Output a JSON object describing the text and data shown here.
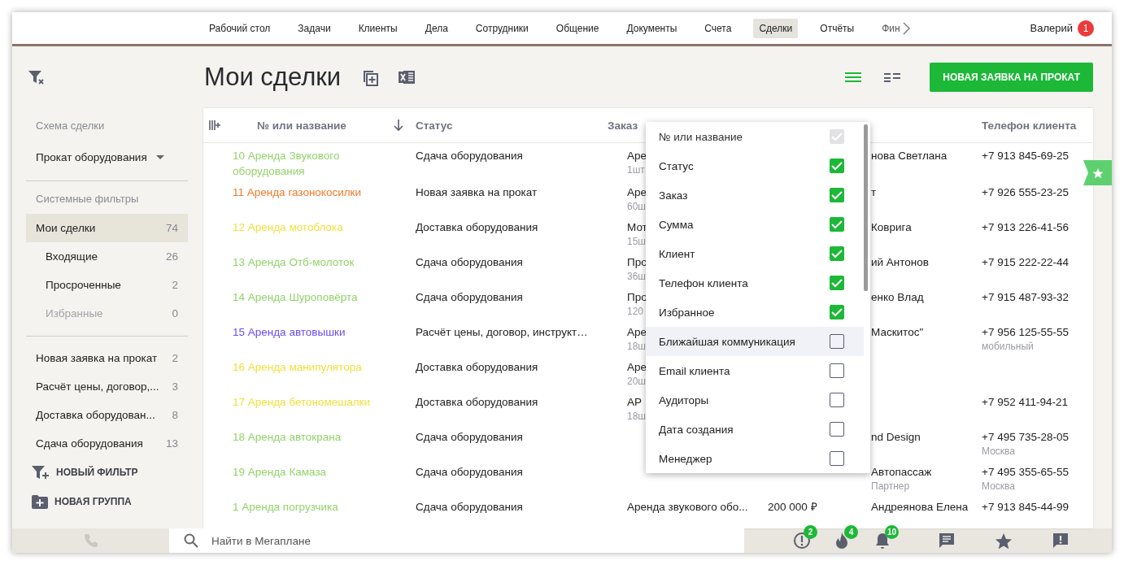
{
  "top_nav": {
    "tabs": [
      {
        "label": "Рабочий стол",
        "selected": false
      },
      {
        "label": "Задачи",
        "selected": false
      },
      {
        "label": "Клиенты",
        "selected": false
      },
      {
        "label": "Дела",
        "selected": false
      },
      {
        "label": "Сотрудники",
        "selected": false
      },
      {
        "label": "Общение",
        "selected": false
      },
      {
        "label": "Документы",
        "selected": false
      },
      {
        "label": "Счета",
        "selected": false
      },
      {
        "label": "Сделки",
        "selected": true
      },
      {
        "label": "Отчёты",
        "selected": false
      },
      {
        "label": "Фин",
        "selected": false
      }
    ],
    "user": {
      "name": "Валерий",
      "badge": "1"
    }
  },
  "sidebar": {
    "scheme_label": "Схема сделки",
    "scheme_value": "Прокат оборудования",
    "system_filters_label": "Системные фильтры",
    "system_filters": [
      {
        "label": "Мои сделки",
        "count": "74",
        "selected": true,
        "disabled": false,
        "children": [
          {
            "label": "Входящие",
            "count": "26",
            "selected": false,
            "disabled": false
          },
          {
            "label": "Просроченные",
            "count": "2",
            "selected": false,
            "disabled": false
          },
          {
            "label": "Избранные",
            "count": "0",
            "selected": false,
            "disabled": true
          }
        ]
      }
    ],
    "groups": [
      {
        "label": "Новая заявка на прокат",
        "count": "2"
      },
      {
        "label": "Расчёт цены, договор,...",
        "count": "3"
      },
      {
        "label": "Доставка оборудован...",
        "count": "8"
      },
      {
        "label": "Сдача оборудования",
        "count": "13"
      }
    ],
    "actions": [
      {
        "kind": "filter",
        "label": "НОВЫЙ ФИЛЬТР"
      },
      {
        "kind": "group",
        "label": "НОВАЯ ГРУППА"
      }
    ]
  },
  "page": {
    "title": "Мои сделки",
    "views": [
      {
        "kind": "list",
        "selected": true
      },
      {
        "kind": "detailed",
        "selected": false
      }
    ],
    "primary_button": "НОВАЯ ЗАЯВКА НА ПРОКАТ"
  },
  "table": {
    "headers": {
      "name": {
        "label": "№ или название",
        "sorted": true
      },
      "status": {
        "label": "Статус",
        "sorted": false
      },
      "order": {
        "label": "Заказ",
        "sorted": false
      },
      "phone": {
        "label": "Телефон клиента",
        "sorted": false
      }
    },
    "rows": [
      {
        "name": "10 Аренда Звукового оборудования",
        "color": "#93d36b",
        "status": "Сдача оборудования",
        "order": "Аре",
        "order_qty": "1шт",
        "client": "нова Светлана",
        "phone": "+7 913 845-69-25"
      },
      {
        "name": "11 Аренда газонокосилки",
        "color": "#f07b2a",
        "status": "Новая заявка на прокат",
        "order": "Аре",
        "order_qty": "60ш",
        "client": "т",
        "phone": "+7 926 555-23-25"
      },
      {
        "name": "12 Аренда мотоблока",
        "color": "#f2df3a",
        "status": "Доставка оборудования",
        "order": "Мот",
        "order_qty": "15ш",
        "client": "Коврига",
        "phone": "+7 913 226-41-56"
      },
      {
        "name": "13 Аренда Отб-молоток",
        "color": "#93d36b",
        "status": "Сдача оборудования",
        "order": "Про",
        "order_qty": "36ш",
        "client": "ий Антонов",
        "phone": "+7 915 222-22-44"
      },
      {
        "name": "14 Аренда Шуроповёрта",
        "color": "#93d36b",
        "status": "Сдача оборудования",
        "order": "Про",
        "order_qty": "120",
        "client": "енко Влад",
        "phone": "+7 915 487-93-32"
      },
      {
        "name": "15 Аренда автовышки",
        "color": "#6a4cf5",
        "status": "Расчёт цены, договор, инструкт…",
        "order": "Аре",
        "order_qty": "18ш",
        "client": "Маскитос\"",
        "phone": "+7 956 125-55-55",
        "phone_note": "мобильный"
      },
      {
        "name": "16 Аренда манипулятора",
        "color": "#f2df3a",
        "status": "Доставка оборудования",
        "order": "Аре",
        "order_qty": "20ш"
      },
      {
        "name": "17 Аренда бетономешалки",
        "color": "#f2df3a",
        "status": "Доставка оборудования",
        "order": "АР",
        "order_qty": "18ш",
        "phone": "+7 952 411-94-21"
      },
      {
        "name": "18 Аренда автокрана",
        "color": "#93d36b",
        "status": "Сдача оборудования",
        "client": "nd Design",
        "phone": "+7 495 735-28-05",
        "phone_note": "Москва"
      },
      {
        "name": "19 Аренда Камаза",
        "color": "#93d36b",
        "status": "Сдача оборудования",
        "client": "Автопассаж",
        "client_note": "Партнер",
        "phone": "+7 495 355-65-55",
        "phone_note": "Москва"
      },
      {
        "name": "1 Аренда погрузчика",
        "color": "#93d36b",
        "status": "Сдача оборудования",
        "order": "Аренда звукового обо...",
        "sum": "200 000 ₽",
        "client": "Андреянова Елена",
        "phone": "+7 913 845-44-99"
      }
    ]
  },
  "column_menu": {
    "items": [
      {
        "label": "№ или название",
        "checked": true,
        "disabled": true,
        "highlighted": false
      },
      {
        "label": "Статус",
        "checked": true,
        "disabled": false,
        "highlighted": false
      },
      {
        "label": "Заказ",
        "checked": true,
        "disabled": false,
        "highlighted": false
      },
      {
        "label": "Сумма",
        "checked": true,
        "disabled": false,
        "highlighted": false
      },
      {
        "label": "Клиент",
        "checked": true,
        "disabled": false,
        "highlighted": false
      },
      {
        "label": "Телефон клиента",
        "checked": true,
        "disabled": false,
        "highlighted": false
      },
      {
        "label": "Избранное",
        "checked": true,
        "disabled": false,
        "highlighted": false
      },
      {
        "label": "Ближайшая коммуникация",
        "checked": false,
        "disabled": false,
        "highlighted": true
      },
      {
        "label": "Email клиента",
        "checked": false,
        "disabled": false,
        "highlighted": false
      },
      {
        "label": "Аудиторы",
        "checked": false,
        "disabled": false,
        "highlighted": false
      },
      {
        "label": "Дата создания",
        "checked": false,
        "disabled": false,
        "highlighted": false
      },
      {
        "label": "Менеджер",
        "checked": false,
        "disabled": false,
        "highlighted": false
      }
    ]
  },
  "bottom_bar": {
    "search_placeholder": "Найти в Мегаплане",
    "icons": [
      {
        "kind": "alert",
        "badge": "2"
      },
      {
        "kind": "fire",
        "badge": "4"
      },
      {
        "kind": "bell",
        "badge": "10"
      },
      {
        "kind": "chat"
      },
      {
        "kind": "star"
      },
      {
        "kind": "report"
      }
    ]
  }
}
